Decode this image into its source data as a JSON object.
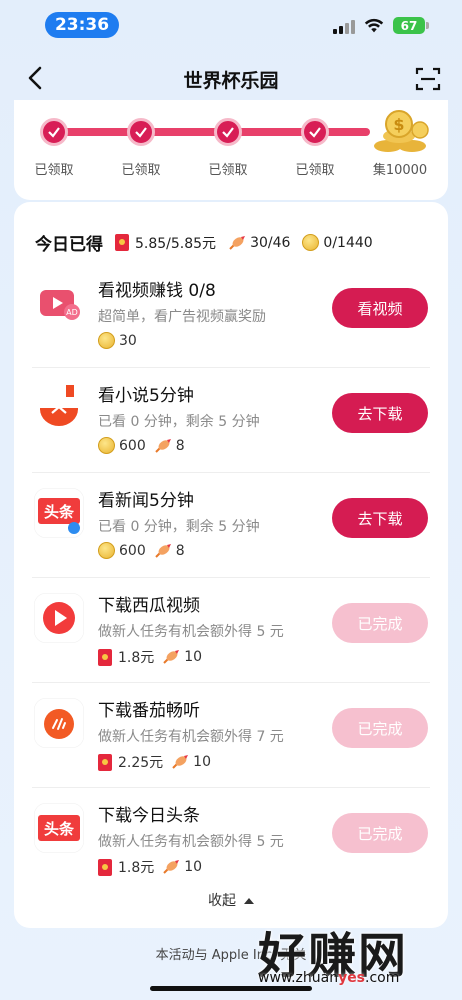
{
  "status_bar": {
    "time": "23:36",
    "battery": "67"
  },
  "nav": {
    "title": "世界杯乐园"
  },
  "progress": {
    "steps": [
      {
        "label": "已领取"
      },
      {
        "label": "已领取"
      },
      {
        "label": "已领取"
      },
      {
        "label": "已领取"
      }
    ],
    "final_label": "集10000"
  },
  "summary": {
    "title": "今日已得",
    "cash": "5.85/5.85元",
    "candy": "30/46",
    "coins": "0/1440"
  },
  "tasks": [
    {
      "title": "看视频赚钱 0/8",
      "desc": "超简单，看广告视频赢奖励",
      "reward1": "30",
      "reward2": "",
      "button": "看视频",
      "state": "active",
      "icon": "video-app-icon"
    },
    {
      "title": "看小说5分钟",
      "desc": "已看 0 分钟，剩余 5 分钟",
      "reward1": "600",
      "reward2": "8",
      "button": "去下载",
      "state": "active",
      "icon": "tomato-novel-icon"
    },
    {
      "title": "看新闻5分钟",
      "desc": "已看 0 分钟，剩余 5 分钟",
      "reward1": "600",
      "reward2": "8",
      "button": "去下载",
      "state": "active",
      "icon": "toutiao-lite-icon"
    },
    {
      "title": "下载西瓜视频",
      "desc": "做新人任务有机会额外得 5 元",
      "reward1": "1.8元",
      "reward2": "10",
      "button": "已完成",
      "state": "done",
      "icon": "xigua-video-icon"
    },
    {
      "title": "下载番茄畅听",
      "desc": "做新人任务有机会额外得 7 元",
      "reward1": "2.25元",
      "reward2": "10",
      "button": "已完成",
      "state": "done",
      "icon": "tomato-listen-icon"
    },
    {
      "title": "下载今日头条",
      "desc": "做新人任务有机会额外得 5 元",
      "reward1": "1.8元",
      "reward2": "10",
      "button": "已完成",
      "state": "done",
      "icon": "toutiao-icon"
    }
  ],
  "collapse_label": "收起",
  "footer": "本活动与 Apple Inc. 无关",
  "watermark": {
    "main": "好赚网",
    "sub_prefix": "www.zhuan",
    "sub_accent": "yes",
    "sub_suffix": ".com"
  },
  "colors": {
    "accent": "#d51c52",
    "done": "#f6c0cf",
    "status_blue": "#1e7cf0",
    "battery_green": "#3bc34a"
  }
}
